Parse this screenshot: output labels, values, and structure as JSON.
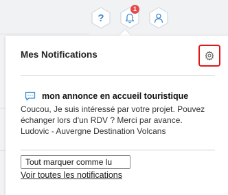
{
  "topbar": {
    "help_glyph": "?",
    "notifications_badge": "1",
    "icons": [
      "help-icon",
      "bell-icon",
      "user-icon"
    ],
    "accent_color": "#3d8bd6",
    "badge_color": "#e44b4b"
  },
  "panel": {
    "title": "Mes Notifications",
    "settings_icon": "gear-icon",
    "highlight_color": "#e01818",
    "notification": {
      "icon": "chat-icon",
      "title": "mon annonce en accueil touristique",
      "body_lines": [
        "Coucou, Je suis intéressé par votre projet. Pouvez",
        "échanger lors d'un RDV ? Merci par avance.",
        "Ludovic - Auvergne Destination Volcans"
      ]
    },
    "mark_all_label": "Tout marquer comme lu",
    "see_all_label": "Voir toutes les notifications"
  }
}
